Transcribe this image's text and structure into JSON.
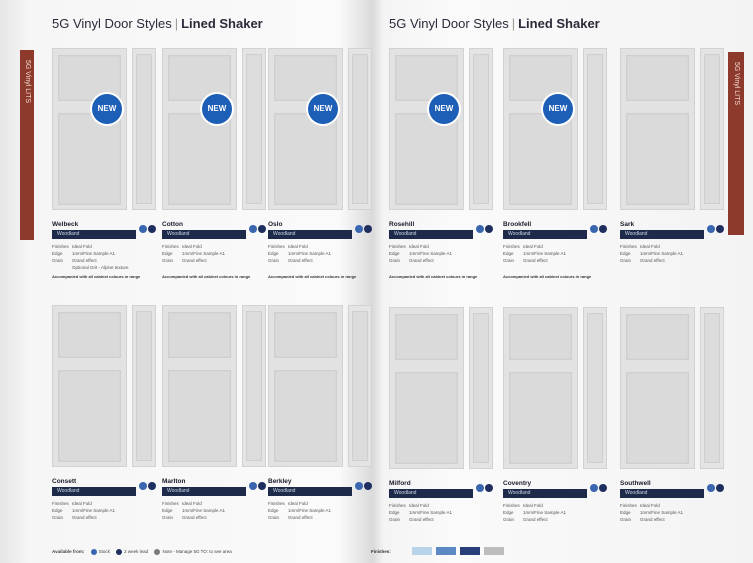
{
  "left_page": {
    "title_prefix": "5G Vinyl Door Styles",
    "title_divider": "|",
    "title_strong": "Lined Shaker",
    "side_tab": "5G Vinyl LITS",
    "page_number": "",
    "footer": {
      "label": "Available from:",
      "legend": [
        "Stock",
        "2 week lead",
        "Note - Manage 5G TO: to see area"
      ]
    },
    "doors": [
      {
        "name": "Welbeck",
        "new": true,
        "bar_label": "Woodland",
        "specs": [
          {
            "k": "Finishes",
            "v": "Ideal Fold"
          },
          {
            "k": "Edge",
            "v": "1mm/Fine Sample A1"
          },
          {
            "k": "Grain",
            "v": "Grand effect"
          },
          {
            "k": "",
            "v": "Optional Grit - Alpine texture"
          }
        ],
        "note": "Accompanied with all cabinet colours in range"
      },
      {
        "name": "Cotton",
        "new": true,
        "bar_label": "Woodland",
        "specs": [
          {
            "k": "Finishes",
            "v": "Ideal Fold"
          },
          {
            "k": "Edge",
            "v": "1mm/Fine Sample A1"
          },
          {
            "k": "Grain",
            "v": "Grand effect"
          }
        ],
        "note": "Accompanied with all cabinet colours in range"
      },
      {
        "name": "Oslo",
        "new": true,
        "bar_label": "Woodland",
        "specs": [
          {
            "k": "Finishes",
            "v": "Ideal Fold"
          },
          {
            "k": "Edge",
            "v": "1mm/Fine Sample A1"
          },
          {
            "k": "Grain",
            "v": "Grand effect"
          }
        ],
        "note": "Accompanied with all cabinet colours in range"
      },
      {
        "name": "Consett",
        "new": false,
        "bar_label": "Woodland",
        "specs": [
          {
            "k": "Finishes",
            "v": "Ideal Fold"
          },
          {
            "k": "Edge",
            "v": "1mm/Fine Sample A1"
          },
          {
            "k": "Grain",
            "v": "Grand effect"
          }
        ],
        "note": ""
      },
      {
        "name": "Marlton",
        "new": false,
        "bar_label": "Woodland",
        "specs": [
          {
            "k": "Finishes",
            "v": "Ideal Fold"
          },
          {
            "k": "Edge",
            "v": "1mm/Fine Sample A1"
          },
          {
            "k": "Grain",
            "v": "Grand effect"
          }
        ],
        "note": ""
      },
      {
        "name": "Berkley",
        "new": false,
        "bar_label": "Woodland",
        "specs": [
          {
            "k": "Finishes",
            "v": "Ideal Fold"
          },
          {
            "k": "Edge",
            "v": "1mm/Fine Sample A1"
          },
          {
            "k": "Grain",
            "v": "Grand effect"
          }
        ],
        "note": ""
      }
    ]
  },
  "right_page": {
    "title_prefix": "5G Vinyl Door Styles",
    "title_divider": "|",
    "title_strong": "Lined Shaker",
    "side_tab": "5G Vinyl LITS",
    "page_number": "",
    "footer": {
      "label": "Finishes:",
      "swatches": [
        "#b9d3ea",
        "#5c89c4",
        "#2a3f7a",
        "#bdbdbd"
      ]
    },
    "doors": [
      {
        "name": "Rosehill",
        "new": true,
        "bar_label": "Woodland",
        "specs": [
          {
            "k": "Finishes",
            "v": "Ideal Fold"
          },
          {
            "k": "Edge",
            "v": "1mm/Fine Sample A1"
          },
          {
            "k": "Grain",
            "v": "Grand effect"
          }
        ],
        "note": "Accompanied with all cabinet colours in range"
      },
      {
        "name": "Brookfell",
        "new": true,
        "bar_label": "Woodland",
        "specs": [
          {
            "k": "Finishes",
            "v": "Ideal Fold"
          },
          {
            "k": "Edge",
            "v": "1mm/Fine Sample A1"
          },
          {
            "k": "Grain",
            "v": "Grand effect"
          }
        ],
        "note": "Accompanied with all cabinet colours in range"
      },
      {
        "name": "Sark",
        "new": false,
        "bar_label": "Woodland",
        "specs": [
          {
            "k": "Finishes",
            "v": "Ideal Fold"
          },
          {
            "k": "Edge",
            "v": "1mm/Fine Sample A1"
          },
          {
            "k": "Grain",
            "v": "Grand effect"
          }
        ],
        "note": ""
      },
      {
        "name": "Milford",
        "new": false,
        "bar_label": "Woodland",
        "specs": [
          {
            "k": "Finishes",
            "v": "Ideal Fold"
          },
          {
            "k": "Edge",
            "v": "1mm/Fine Sample A1"
          },
          {
            "k": "Grain",
            "v": "Grand effect"
          }
        ],
        "note": ""
      },
      {
        "name": "Coventry",
        "new": false,
        "bar_label": "Woodland",
        "specs": [
          {
            "k": "Finishes",
            "v": "Ideal Fold"
          },
          {
            "k": "Edge",
            "v": "1mm/Fine Sample A1"
          },
          {
            "k": "Grain",
            "v": "Grand effect"
          }
        ],
        "note": ""
      },
      {
        "name": "Southwell",
        "new": false,
        "bar_label": "Woodland",
        "specs": [
          {
            "k": "Finishes",
            "v": "Ideal Fold"
          },
          {
            "k": "Edge",
            "v": "1mm/Fine Sample A1"
          },
          {
            "k": "Grain",
            "v": "Grand effect"
          }
        ],
        "note": ""
      }
    ]
  },
  "badge_label": "NEW",
  "colors": {
    "accent_blue": "#1d5eb6",
    "navy": "#1e2a4a",
    "brick": "#8d3a2c"
  }
}
